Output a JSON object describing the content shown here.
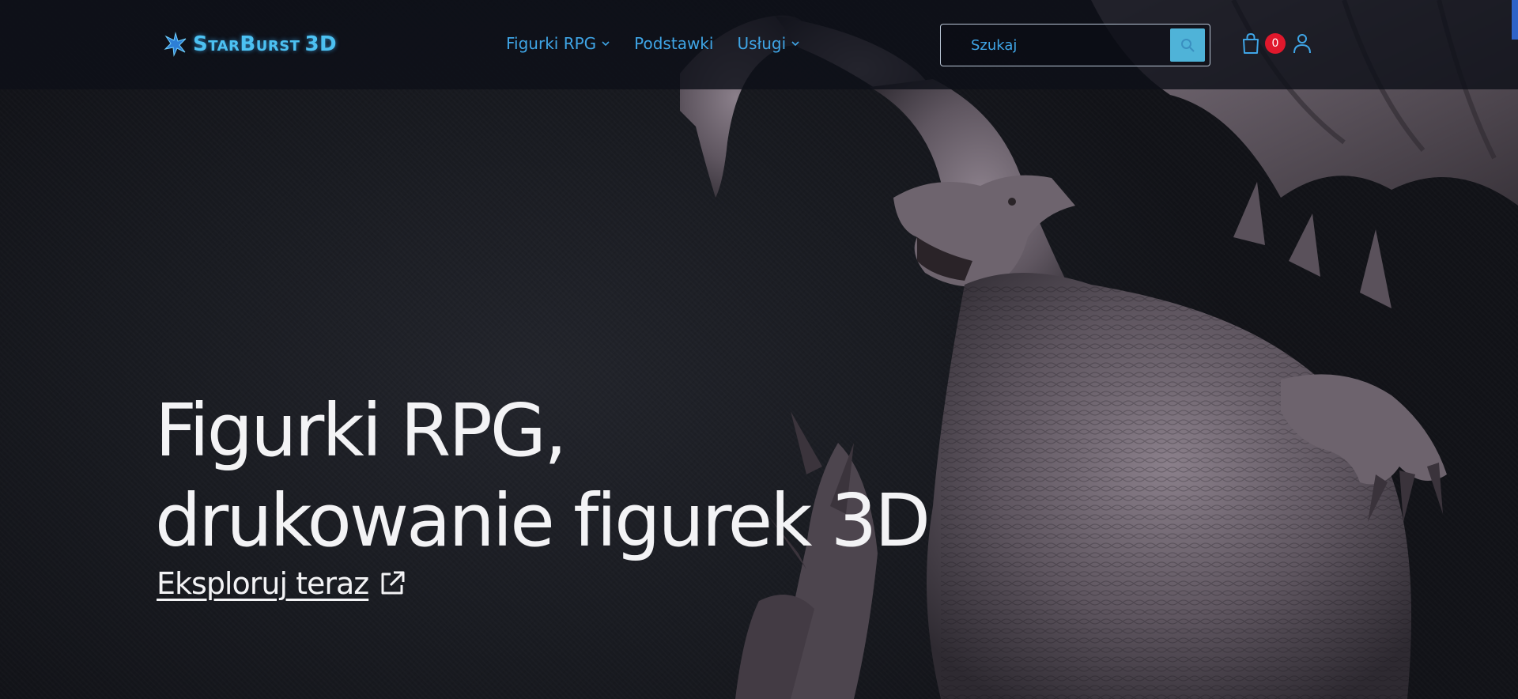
{
  "brand": {
    "logo_text": "StarBurst 3D",
    "logo_part1": "StarBurst",
    "logo_part2": "3D",
    "accent_color": "#4cc1f2"
  },
  "nav": {
    "items": [
      {
        "label": "Figurki RPG",
        "has_dropdown": true,
        "icon": "chevron-down-icon"
      },
      {
        "label": "Podstawki",
        "has_dropdown": false
      },
      {
        "label": "Usługi",
        "has_dropdown": true,
        "icon": "chevron-down-icon"
      }
    ]
  },
  "search": {
    "placeholder": "Szukaj",
    "button_icon": "search-icon",
    "button_color": "#4fb3d8"
  },
  "cart": {
    "icon": "shopping-bag-icon",
    "count": "0",
    "badge_color": "#e0182c"
  },
  "account": {
    "icon": "user-icon"
  },
  "hero": {
    "title_line1": "Figurki RPG,",
    "title_line2": "drukowanie figurek 3D",
    "cta_label": "Eksploruj teraz",
    "cta_icon": "external-link-icon"
  }
}
